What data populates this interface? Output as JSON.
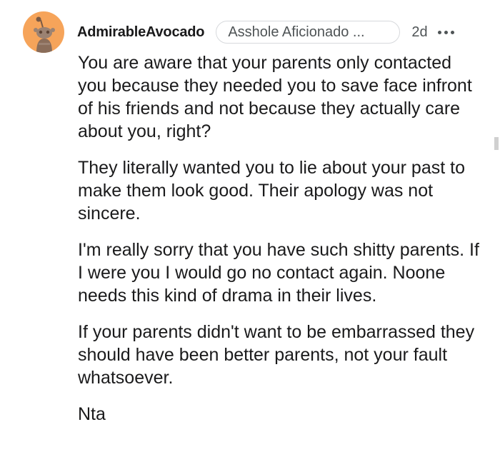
{
  "comment": {
    "username": "AdmirableAvocado",
    "flair": "Asshole Aficionado ...",
    "age": "2d",
    "paragraphs": [
      "You are aware that your parents only contacted you because they needed you to save face infront of his friends and not because they actually care about you, right?",
      "They literally wanted you to lie about your past to make them look good. Their apology was not sincere.",
      "I'm really sorry that you have such shitty parents. If I were you I would go no contact again. Noone needs this kind of drama in their lives.",
      "If your parents didn't want to be embarrassed they should have been better parents, not your fault whatsoever.",
      "Nta"
    ]
  },
  "icons": {
    "avatar": "snoo-avatar-icon",
    "more": "more-options-icon"
  },
  "colors": {
    "avatar_bg": "#f6a45a",
    "text": "#1a1a1b",
    "meta": "#4f5456",
    "flair_border": "#d7d9dc"
  }
}
